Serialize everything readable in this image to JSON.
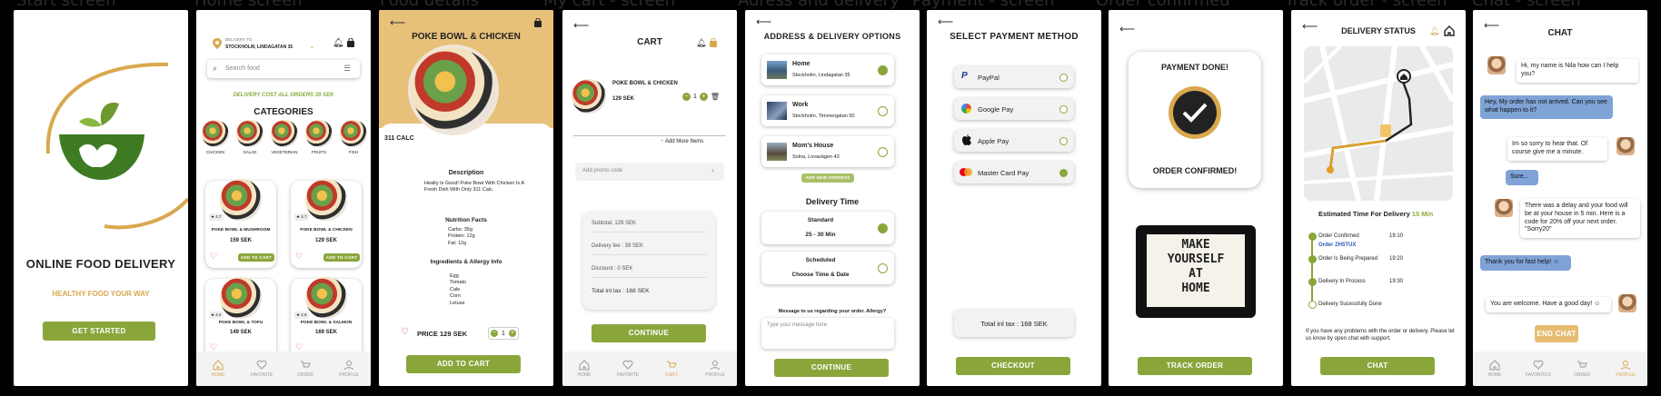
{
  "screen_titles": [
    "Start screen",
    "Home screen",
    "Food details",
    "My cart - screen",
    "Adress and delivery",
    "Payment - screen",
    "Order confirmed",
    "Track order - screen",
    "Chat - screen"
  ],
  "colors": {
    "green": "#8aa63b",
    "gold": "#d9a84e",
    "blue_bubble": "#7fa3d6",
    "dark": "#222222"
  },
  "start": {
    "title": "ONLINE FOOD DELIVERY",
    "subtitle": "HEALTHY FOOD YOUR WAY",
    "button": "GET STARTED"
  },
  "home": {
    "delivery_to": "DELIVERY TO",
    "address": "STOCKHOLM, LINDAGATAN 35",
    "search_placeholder": "Search food",
    "promo": "DELIVERY COST ALL ORDERS 39 SEK",
    "categories_title": "CATEGORIES",
    "categories": [
      "CHICKEN",
      "SALAD",
      "VEGETERIAN",
      "FRUITS",
      "FISH"
    ],
    "items": [
      {
        "rating": "4.7",
        "name": "POKE BOWL & MUSHROOM",
        "price": "159 SEK",
        "add": "ADD TO CART"
      },
      {
        "rating": "4.7",
        "name": "POKE BOWL & CHICKEN",
        "price": "129 SEK",
        "add": "ADD TO CART"
      },
      {
        "rating": "4.4",
        "name": "POKE BOWL & TOFU",
        "price": "149 SEK",
        "add": "ADD TO CART"
      },
      {
        "rating": "4.6",
        "name": "POKE BOWL & SALMON",
        "price": "169 SEK",
        "add": "ADD TO CART"
      }
    ]
  },
  "nav": {
    "home": "HOME",
    "favorite": "FAVORITE",
    "order": "ORDER",
    "profile": "PROFILE",
    "favorites": "FAVORITES"
  },
  "details": {
    "title": "POKE BOWL & CHICKEN",
    "calories": "311 CALC",
    "desc_title": "Description",
    "desc": "Healty Is Good! Poke Bowl With Chicken Is A Fresh Dish With Only 311 Calc.",
    "nutrition_title": "Nutrition Facts",
    "nutrition": [
      "Carbs: 35g",
      "Protein: 12g",
      "Fat: 12g"
    ],
    "ingredients_title": "Ingredients & Allergy Info",
    "ingredients": [
      "Egg",
      "Tomato",
      "Cale",
      "Corn",
      "Letuse"
    ],
    "price": "PRICE 129 SEK",
    "qty": "1",
    "button": "ADD TO CART"
  },
  "cart": {
    "title": "CART",
    "item": "POKE BOWL & CHICKEN",
    "price": "129 SEK",
    "qty": "1",
    "add_more": "Add More Items",
    "promo_placeholder": "Add promo code",
    "subtotal": "Subtotal:   129 SEK",
    "delivery": "Delivery fee :   39 SEK",
    "discount": "Discount :   0 SEK",
    "total": "Total inl tax :   168 SEK",
    "button": "CONTINUE"
  },
  "address": {
    "title": "ADDRESS & DELIVERY OPTIONS",
    "options": [
      {
        "name": "Home",
        "addr": "Stockholm, Lindagatan 35"
      },
      {
        "name": "Work",
        "addr": "Stockholm, Timmergatan 50"
      },
      {
        "name": "Mom's House",
        "addr": "Solna, Lovavägen 43"
      }
    ],
    "add_new": "ADD NEW ADDRESS",
    "delivery_time": "Delivery Time",
    "standard": "Standard",
    "standard_time": "25 - 30 Min",
    "scheduled": "Scheduled",
    "scheduled_sub": "Choose Time & Date",
    "message_label": "Message to us regarding your order. Allergy?",
    "message_placeholder": "Type your message here",
    "button": "CONTINUE"
  },
  "payment": {
    "title": "SELECT PAYMENT METHOD",
    "methods": [
      "PayPal",
      "Google Pay",
      "Apple Pay",
      "Master  Card Pay"
    ],
    "total": "Total inl tax :   168 SEK",
    "button": "CHECKOUT"
  },
  "confirmed": {
    "payment_done": "PAYMENT DONE!",
    "order_confirmed": "ORDER CONFIRMED!",
    "sign": [
      "MAKE",
      "YOURSELF",
      "AT",
      "HOME"
    ],
    "button": "TRACK ORDER"
  },
  "track": {
    "title": "DELIVERY STATUS",
    "eta_label": "Estimated Time For Delivery",
    "eta": "15 Min",
    "steps": [
      {
        "label": "Order Confirmed",
        "time": "19:10"
      },
      {
        "label": "Order ZH5TUX",
        "time": ""
      },
      {
        "label": "Order Is Being Prepared",
        "time": "19:20"
      },
      {
        "label": "Delivery In Process",
        "time": "19:30"
      },
      {
        "label": "Delivery Sucessfully Done",
        "time": ""
      }
    ],
    "help": "If you have any problems with the order or delivery. Please let us know by open chat with support.",
    "button": "CHAT"
  },
  "chat": {
    "title": "CHAT",
    "messages": [
      "Hi, my name is Nila how can I help you?",
      "Hey,  My order has not arrived. Can you see what happen to it?",
      "Im so sorry to hear that. Of course give me a minute.",
      "Sure...",
      "There was a delay and your food will be at your house in 5 min. Here is a code for 20% off your next order. \"Sorry20\"",
      "Thank you for fast help! ☺",
      "You are welcome. Have a good day! ☺"
    ],
    "button": "END CHAT"
  }
}
